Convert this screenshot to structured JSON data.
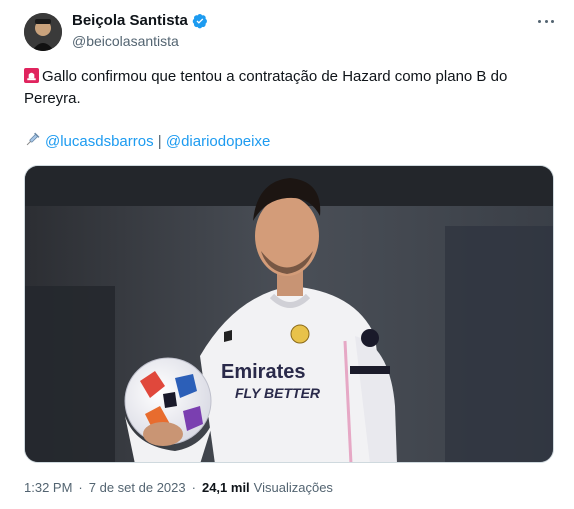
{
  "author": {
    "name": "Beiçola Santista",
    "handle": "@beicolasantista",
    "verified": true
  },
  "tweet": {
    "text": "Gallo confirmou que tentou a contratação de Hazard como plano B do Pereyra.",
    "credit_link_1": "@lucasdsbarros",
    "credit_separator": "|",
    "credit_link_2": "@diariodopeixe",
    "image_alt": "Eden Hazard in Real Madrid white kit holding a Champions League ball",
    "shirt_text_1": "Emirates",
    "shirt_text_2": "FLY BETTER"
  },
  "meta": {
    "time": "1:32 PM",
    "dot": "·",
    "date": "7 de set de 2023",
    "views_count": "24,1 mil",
    "views_label": "Visualizações"
  },
  "colors": {
    "link": "#1d9bf0",
    "secondary_text": "#536471",
    "verified_badge": "#1d9bf0"
  }
}
